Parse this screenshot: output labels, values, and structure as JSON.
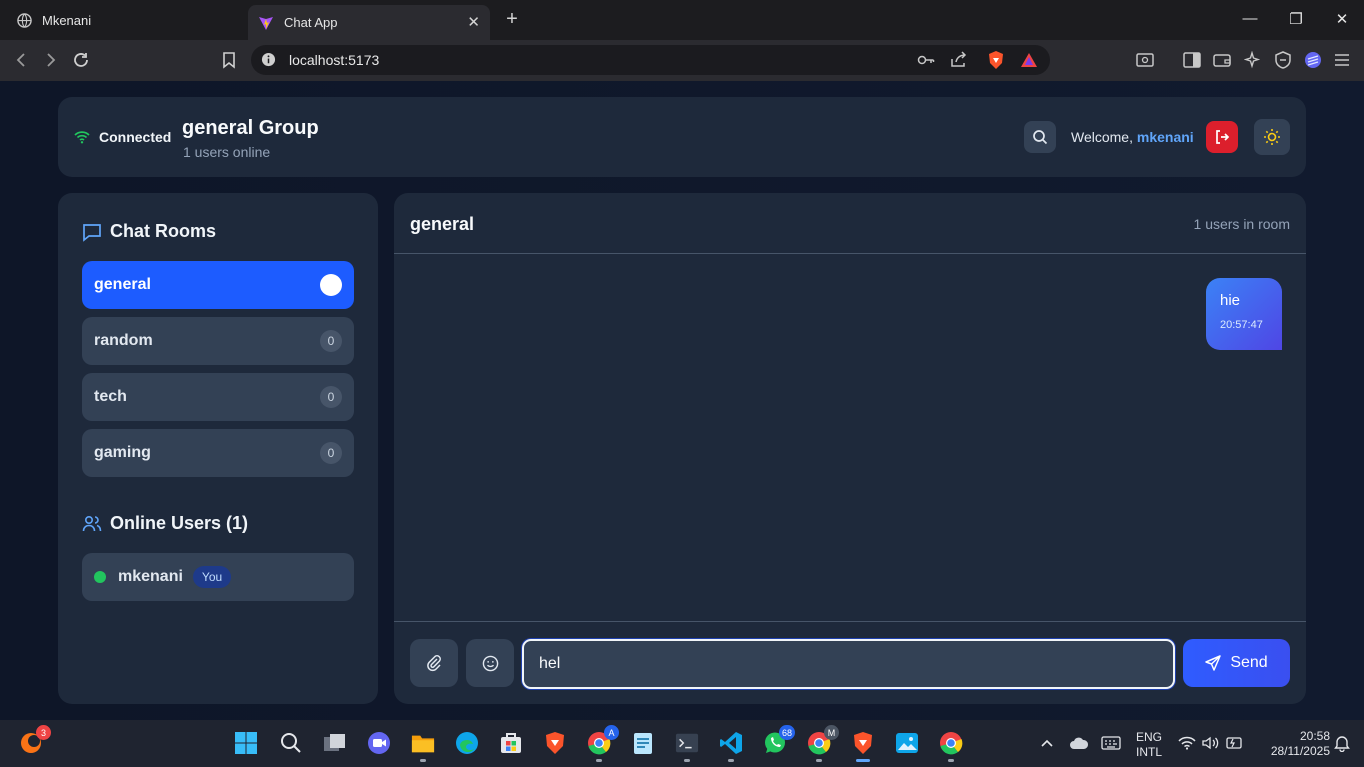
{
  "browser": {
    "tabs": [
      {
        "title": "Mkenani",
        "active": false
      },
      {
        "title": "Chat App",
        "active": true
      }
    ],
    "url": "localhost:5173"
  },
  "header": {
    "status": "Connected",
    "group_title": "general Group",
    "group_subtitle": "1 users online",
    "welcome_prefix": "Welcome, ",
    "username": "mkenani"
  },
  "sidebar": {
    "rooms_title": "Chat Rooms",
    "rooms": [
      {
        "name": "general",
        "count": "",
        "active": true
      },
      {
        "name": "random",
        "count": "0",
        "active": false
      },
      {
        "name": "tech",
        "count": "0",
        "active": false
      },
      {
        "name": "gaming",
        "count": "0",
        "active": false
      }
    ],
    "users_title": "Online Users (1)",
    "users": [
      {
        "name": "mkenani",
        "badge": "You"
      }
    ]
  },
  "chat": {
    "room_name": "general",
    "room_count": "1 users in room",
    "messages": [
      {
        "text": "hie",
        "time": "20:57:47",
        "own": true
      }
    ],
    "input_value": "hel",
    "send_label": "Send"
  },
  "taskbar": {
    "language": "ENG",
    "layout": "INTL",
    "time": "20:58",
    "date": "28/11/2025",
    "badges": {
      "start_app": "3",
      "whatsapp": "68",
      "chrome_a": "A",
      "chrome_m": "M"
    }
  },
  "colors": {
    "accent": "#1d5cff",
    "online": "#22c55e",
    "logout": "#dc1f2c",
    "background": "#0f172a",
    "panel": "#1e293b"
  }
}
